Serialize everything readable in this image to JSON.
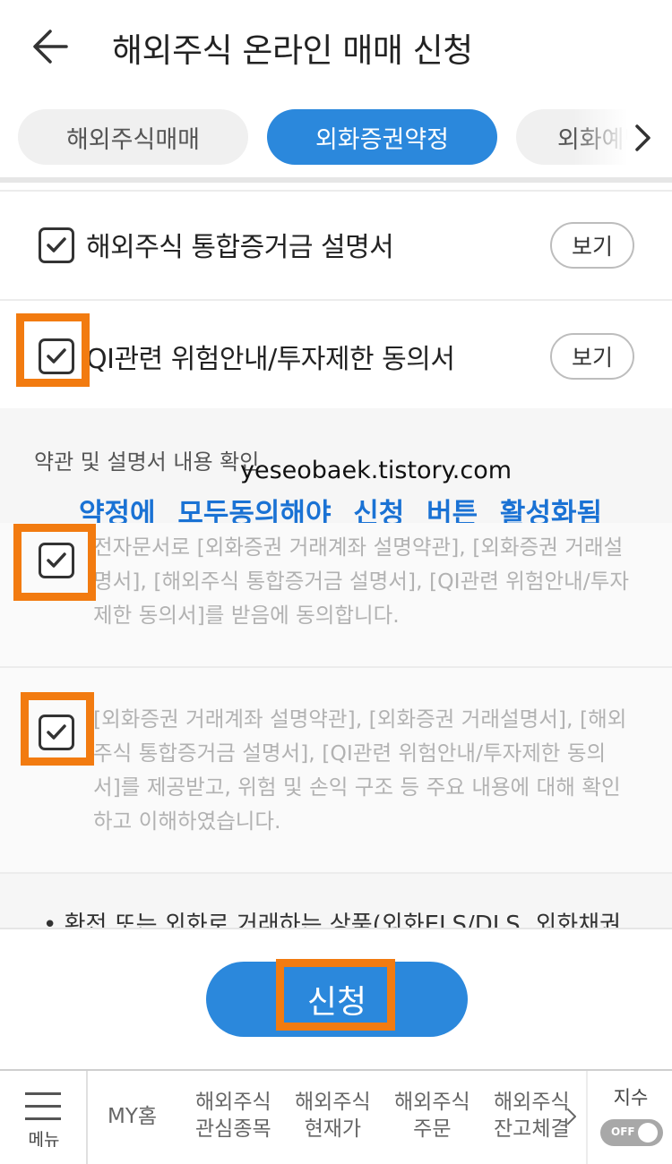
{
  "header": {
    "title": "해외주식 온라인 매매 신청"
  },
  "tabs": [
    {
      "label": "해외주식매매",
      "active": false
    },
    {
      "label": "외화증권약정",
      "active": true
    },
    {
      "label": "외화예탁",
      "active": false
    }
  ],
  "documents": [
    {
      "label": "해외주식 통합증거금 설명서",
      "checked": true,
      "view_label": "보기"
    },
    {
      "label": "QI관련 위험안내/투자제한 동의서",
      "checked": true,
      "view_label": "보기"
    }
  ],
  "section": {
    "title": "약관 및 설명서 내용 확인"
  },
  "watermark": "yeseobaek.tistory.com",
  "overlay_note": "약정에 모두동의해야 신청 버튼 활성화됨",
  "agreements": [
    {
      "checked": true,
      "text": "전자문서로 [외화증권 거래계좌 설명약관], [외화증권 거래설명서], [해외주식 통합증거금 설명서], [QI관련 위험안내/투자제한 동의서]를 받음에 동의합니다."
    },
    {
      "checked": true,
      "text": "[외화증권 거래계좌 설명약관], [외화증권 거래설명서], [해외주식 통합증거금 설명서], [QI관련 위험안내/투자제한 동의서]를 제공받고, 위험 및 손익 구조 등 주요 내용에 대해 확인하고 이해하였습니다."
    }
  ],
  "notice": {
    "bullet": "•",
    "text": "환전 또는 외화로 거래하는 상품(외화ELS/DLS, 외화채권"
  },
  "submit": {
    "label": "신청"
  },
  "bottom_nav": {
    "menu_label": "메뉴",
    "items": [
      "MY홈",
      "해외주식\n관심종목",
      "해외주식\n현재가",
      "해외주식\n주문",
      "해외주식\n잔고체결"
    ],
    "index_label": "지수",
    "toggle_label": "OFF"
  },
  "colors": {
    "accent": "#2b88dc",
    "highlight": "#f27b10",
    "note": "#1a72d4"
  }
}
